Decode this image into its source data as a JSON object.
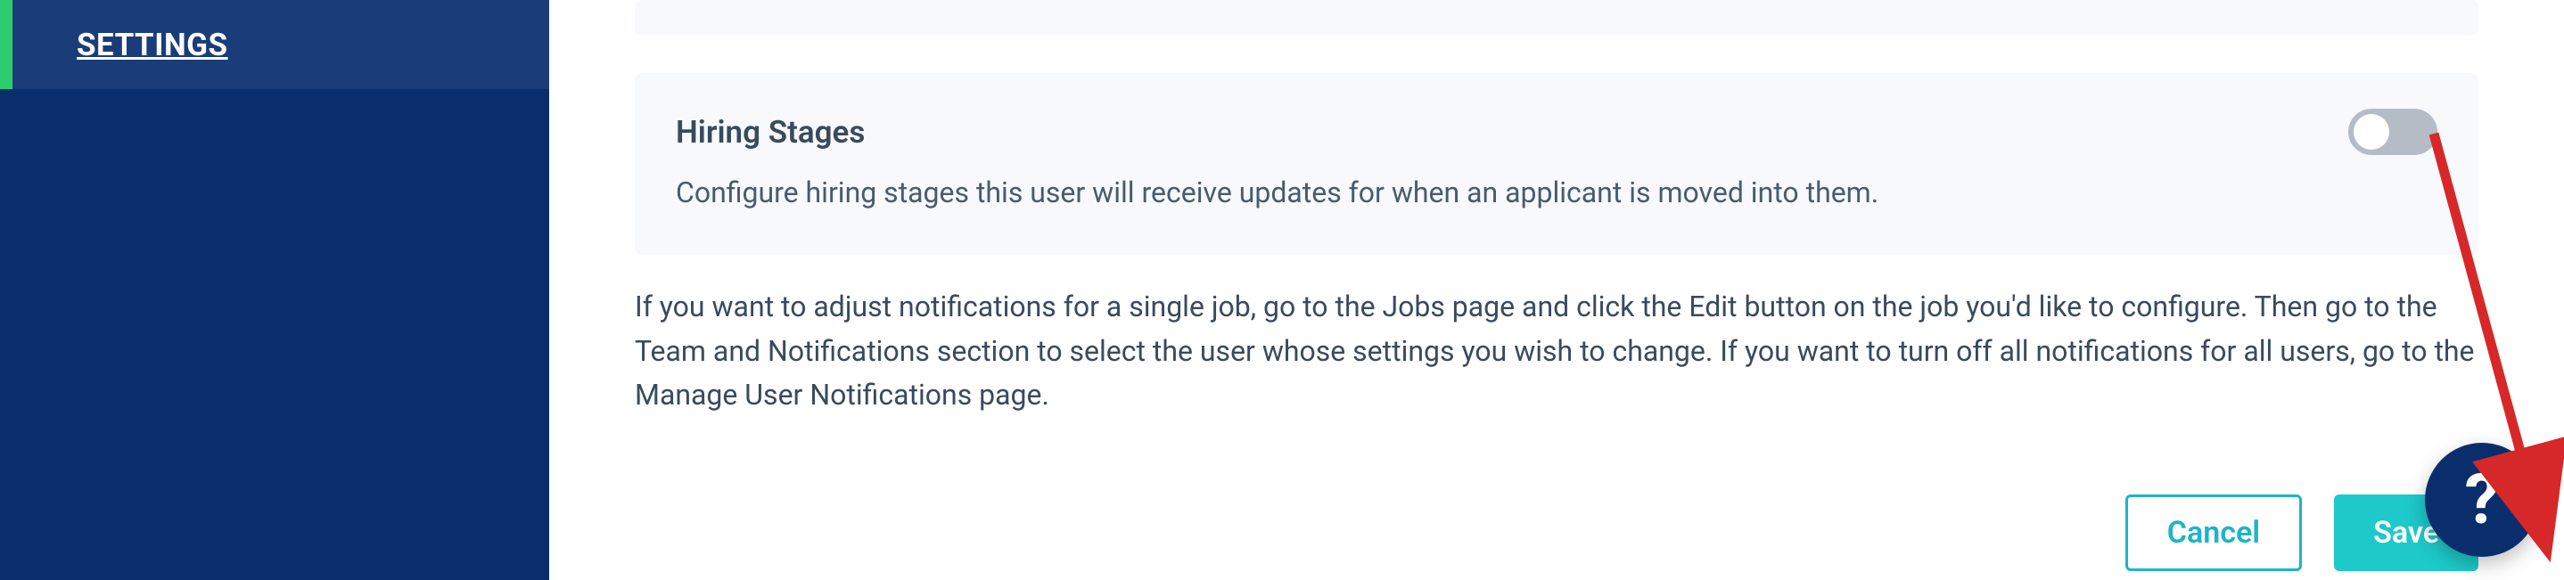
{
  "sidebar": {
    "items": [
      {
        "label": "SETTINGS"
      }
    ]
  },
  "card": {
    "title": "Hiring Stages",
    "description": "Configure hiring stages this user will receive updates for when an applicant is moved into them.",
    "toggle_state": "off"
  },
  "help_text": "If you want to adjust notifications for a single job, go to the Jobs page and click the Edit button on the job you'd like to configure. Then go to the Team and Notifications section to select the user whose settings you wish to change. If you want to turn off all notifications for all users, go to the Manage User Notifications page.",
  "actions": {
    "cancel_label": "Cancel",
    "save_label": "Save"
  },
  "fab": {
    "label": "?"
  },
  "colors": {
    "sidebar_bg": "#0a2e6b",
    "sidebar_active": "#1a3d7a",
    "accent_green": "#2ecc71",
    "card_bg": "#f7f9fc",
    "teal": "#1dc9c9",
    "arrow": "#d62828"
  }
}
